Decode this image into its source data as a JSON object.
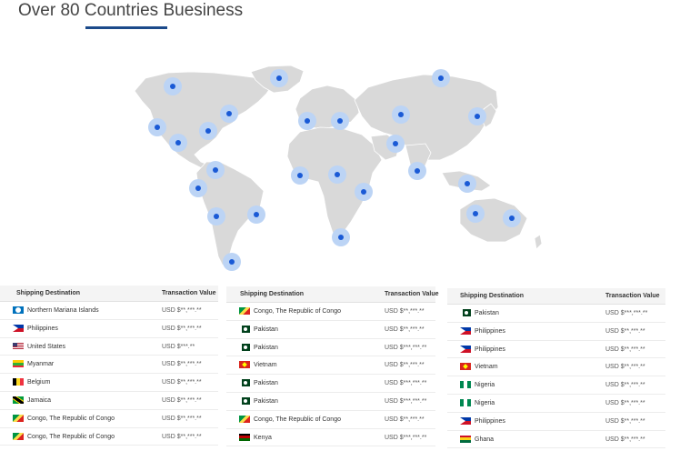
{
  "page": {
    "title": "Over 80 Countries Buesiness"
  },
  "colors": {
    "accent": "#1b4a8a",
    "map_land": "#d9d9d9",
    "marker": "#1a5ad6",
    "marker_halo": "#bcd4f5"
  },
  "tables": [
    {
      "headers": {
        "destination": "Shipping Destination",
        "value": "Transaction Value"
      },
      "rows": [
        {
          "country": "Northern Mariana Islands",
          "flag": "nmi",
          "value": "USD $**,***.**"
        },
        {
          "country": "Philippines",
          "flag": "ph",
          "value": "USD $**,***.**"
        },
        {
          "country": "United States",
          "flag": "us",
          "value": "USD $***.**"
        },
        {
          "country": "Myanmar",
          "flag": "mm",
          "value": "USD $**,***.**"
        },
        {
          "country": "Belgium",
          "flag": "be",
          "value": "USD $**,***.**"
        },
        {
          "country": "Jamaica",
          "flag": "jm",
          "value": "USD $**,***.**"
        },
        {
          "country": "Congo, The Republic of Congo",
          "flag": "cg",
          "value": "USD $**,***.**"
        },
        {
          "country": "Congo, The Republic of Congo",
          "flag": "cg",
          "value": "USD $**,***.**"
        }
      ]
    },
    {
      "headers": {
        "destination": "Shipping Destination",
        "value": "Transaction Value"
      },
      "rows": [
        {
          "country": "Congo, The Republic of Congo",
          "flag": "cg",
          "value": "USD $**,***.**"
        },
        {
          "country": "Pakistan",
          "flag": "pk",
          "value": "USD $**,***.**"
        },
        {
          "country": "Pakistan",
          "flag": "pk",
          "value": "USD $***,***.**"
        },
        {
          "country": "Vietnam",
          "flag": "vn",
          "value": "USD $**,***.**"
        },
        {
          "country": "Pakistan",
          "flag": "pk",
          "value": "USD $***,***.**"
        },
        {
          "country": "Pakistan",
          "flag": "pk",
          "value": "USD $***,***.**"
        },
        {
          "country": "Congo, The Republic of Congo",
          "flag": "cg",
          "value": "USD $**,***.**"
        },
        {
          "country": "Kenya",
          "flag": "ke",
          "value": "USD $***,***.**"
        }
      ]
    },
    {
      "headers": {
        "destination": "Shipping Destination",
        "value": "Transaction Value"
      },
      "rows": [
        {
          "country": "Pakistan",
          "flag": "pk",
          "value": "USD $***,***.**"
        },
        {
          "country": "Philippines",
          "flag": "ph",
          "value": "USD $**,***.**"
        },
        {
          "country": "Philippines",
          "flag": "ph",
          "value": "USD $**,***.**"
        },
        {
          "country": "Vietnam",
          "flag": "vn",
          "value": "USD $**,***.**"
        },
        {
          "country": "Nigeria",
          "flag": "ng",
          "value": "USD $**,***.**"
        },
        {
          "country": "Nigeria",
          "flag": "ng",
          "value": "USD $**,***.**"
        },
        {
          "country": "Philippines",
          "flag": "ph",
          "value": "USD $**,***.**"
        },
        {
          "country": "Ghana",
          "flag": "gh",
          "value": "USD $**,***.**"
        }
      ]
    }
  ]
}
